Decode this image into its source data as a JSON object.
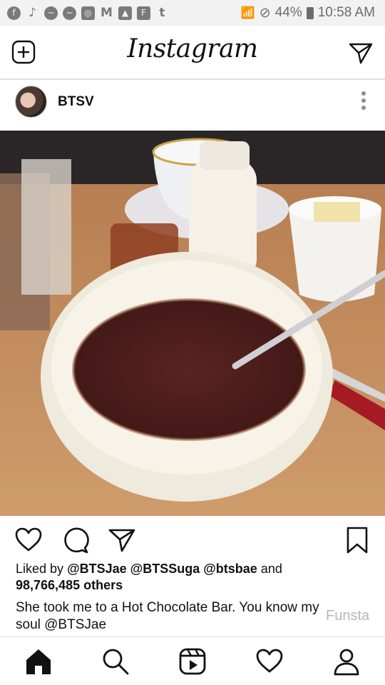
{
  "status_bar": {
    "notification_icons": [
      "facebook-icon",
      "tiktok-icon",
      "messenger-icon",
      "messenger-icon",
      "instagram-icon",
      "gmail-icon",
      "gallery-icon",
      "flipboard-icon",
      "tumblr-icon"
    ],
    "battery": "44%",
    "time": "10:58 AM"
  },
  "header": {
    "logo": "Instagram"
  },
  "post": {
    "username": "BTSV",
    "likes": {
      "prefix": "Liked by",
      "users": [
        "@BTSJae",
        "@BTSSuga",
        "@btsbae"
      ],
      "conjunction": "and",
      "others": "98,766,485 others"
    },
    "caption": "She took me to a Hot Chocolate Bar.  You know my soul @BTSJae"
  },
  "watermark": "Funsta",
  "bottom_nav": [
    "home-icon",
    "search-icon",
    "reels-icon",
    "heart-icon",
    "profile-icon"
  ]
}
